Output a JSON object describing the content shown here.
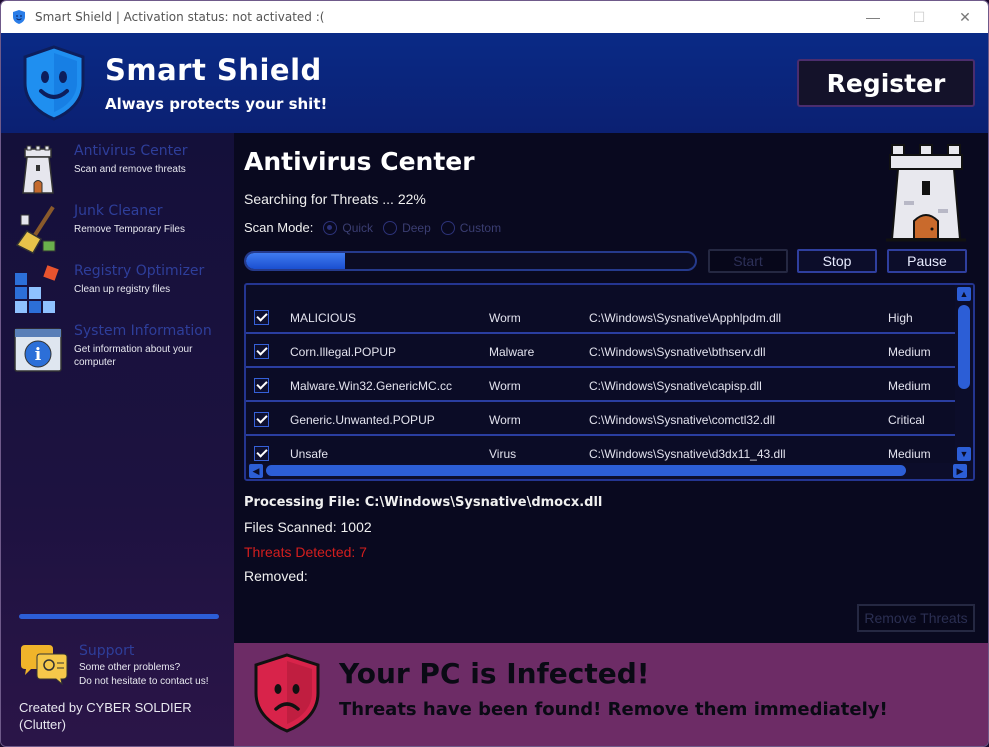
{
  "window": {
    "title": "Smart Shield | Activation status: not activated :(",
    "minimize": "—",
    "maximize": "☐",
    "close": "✕"
  },
  "header": {
    "brand_name": "Smart Shield",
    "tagline": "Always protects your shit!",
    "register_label": "Register"
  },
  "sidebar": {
    "items": [
      {
        "title": "Antivirus Center",
        "subtitle": "Scan and remove threats",
        "icon": "tower-icon"
      },
      {
        "title": "Junk Cleaner",
        "subtitle": "Remove Temporary Files",
        "icon": "broom-icon"
      },
      {
        "title": "Registry Optimizer",
        "subtitle": "Clean up registry files",
        "icon": "blocks-icon"
      },
      {
        "title": "System Information",
        "subtitle": "Get information about your computer",
        "icon": "info-icon"
      }
    ],
    "support": {
      "title": "Support",
      "line1": "Some other problems?",
      "line2": "Do not hesitate to contact us!"
    },
    "created_by": "Created by CYBER SOLDIER (Clutter)"
  },
  "main": {
    "title": "Antivirus Center",
    "status": "Searching for Threats ... 22%",
    "progress_fraction": 0.22,
    "scan_mode_label": "Scan Mode:",
    "scan_modes": [
      {
        "label": "Quick",
        "checked": true
      },
      {
        "label": "Deep",
        "checked": false
      },
      {
        "label": "Custom",
        "checked": false
      }
    ],
    "buttons": {
      "start": "Start",
      "stop": "Stop",
      "pause": "Pause"
    },
    "threats": [
      {
        "name": "MALICIOUS",
        "type": "Worm",
        "path": "C:\\Windows\\Sysnative\\Apphlpdm.dll",
        "severity": "High"
      },
      {
        "name": "Corn.Illegal.POPUP",
        "type": "Malware",
        "path": "C:\\Windows\\Sysnative\\bthserv.dll",
        "severity": "Medium"
      },
      {
        "name": "Malware.Win32.GenericMC.cc",
        "type": "Worm",
        "path": "C:\\Windows\\Sysnative\\capisp.dll",
        "severity": "Medium"
      },
      {
        "name": "Generic.Unwanted.POPUP",
        "type": "Worm",
        "path": "C:\\Windows\\Sysnative\\comctl32.dll",
        "severity": "Critical"
      },
      {
        "name": "Unsafe",
        "type": "Virus",
        "path": "C:\\Windows\\Sysnative\\d3dx11_43.dll",
        "severity": "Medium"
      }
    ],
    "processing_file": "Processing File: C:\\Windows\\Sysnative\\dmocx.dll",
    "files_scanned": "Files Scanned: 1002",
    "threats_detected": "Threats Detected: 7",
    "removed": "Removed:",
    "remove_threats_label": "Remove Threats"
  },
  "banner": {
    "title": "Your PC is Infected!",
    "subtitle": "Threats have been found! Remove them immediately!"
  },
  "colors": {
    "accent": "#2c5ed6",
    "header_bg": "#0a2a86",
    "banner_bg": "#6d2c66",
    "danger": "#d31e1e"
  }
}
